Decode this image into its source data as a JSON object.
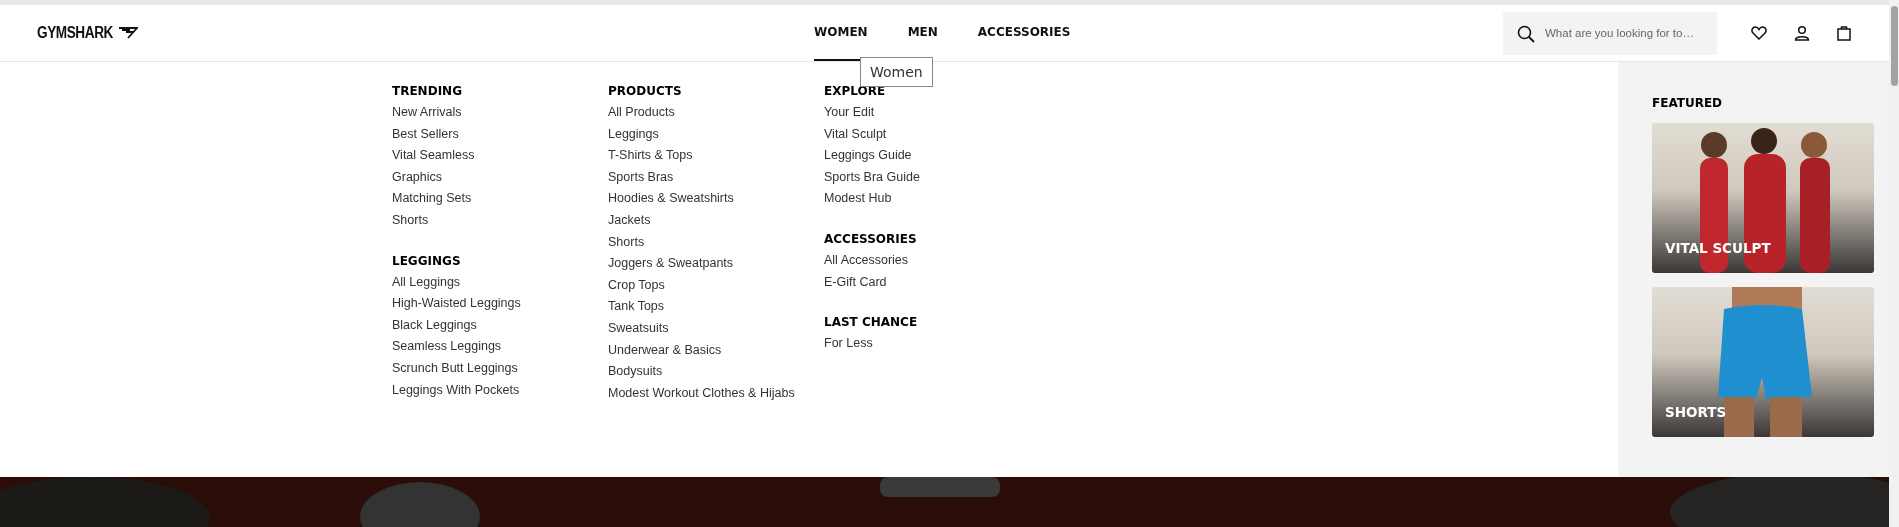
{
  "header": {
    "logo": "GYMSHARK",
    "nav": [
      {
        "label": "WOMEN",
        "selected": true
      },
      {
        "label": "MEN",
        "selected": false
      },
      {
        "label": "ACCESSORIES",
        "selected": false
      }
    ],
    "search": {
      "placeholder": "What are you looking for to…"
    }
  },
  "tooltip": "Women",
  "menu": {
    "columns": [
      {
        "sections": [
          {
            "heading": "TRENDING",
            "links": [
              "New Arrivals",
              "Best Sellers",
              "Vital Seamless",
              "Graphics",
              "Matching Sets",
              "Shorts"
            ]
          },
          {
            "heading": "LEGGINGS",
            "links": [
              "All Leggings",
              "High-Waisted Leggings",
              "Black Leggings",
              "Seamless Leggings",
              "Scrunch Butt Leggings",
              "Leggings With Pockets"
            ]
          }
        ]
      },
      {
        "sections": [
          {
            "heading": "PRODUCTS",
            "links": [
              "All Products",
              "Leggings",
              "T-Shirts & Tops",
              "Sports Bras",
              "Hoodies & Sweatshirts",
              "Jackets",
              "Shorts",
              "Joggers & Sweatpants",
              "Crop Tops",
              "Tank Tops",
              "Sweatsuits",
              "Underwear & Basics",
              "Bodysuits",
              "Modest Workout Clothes & Hijabs"
            ]
          }
        ]
      },
      {
        "sections": [
          {
            "heading": "EXPLORE",
            "links": [
              "Your Edit",
              "Vital Sculpt",
              "Leggings Guide",
              "Sports Bra Guide",
              "Modest Hub"
            ]
          },
          {
            "heading": "ACCESSORIES",
            "links": [
              "All Accessories",
              "E-Gift Card"
            ]
          },
          {
            "heading": "LAST CHANCE",
            "links": [
              "For Less"
            ]
          }
        ]
      }
    ]
  },
  "featured": {
    "heading": "FEATURED",
    "cards": [
      {
        "title": "VITAL SCULPT",
        "kind": "picture"
      },
      {
        "title": "SHORTS",
        "kind": "picture"
      }
    ]
  }
}
